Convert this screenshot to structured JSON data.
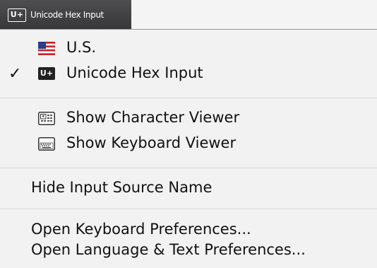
{
  "menubar": {
    "badge": "U+",
    "title": "Unicode Hex Input"
  },
  "menu": {
    "items": [
      {
        "label": "U.S.",
        "icon": "us-flag-icon",
        "checked": false
      },
      {
        "label": "Unicode Hex Input",
        "icon": "unicode-hex-icon",
        "checked": true,
        "badge": "U+",
        "check_mark": "✓"
      },
      {
        "label": "Show Character Viewer",
        "icon": "character-viewer-icon"
      },
      {
        "label": "Show Keyboard Viewer",
        "icon": "keyboard-viewer-icon"
      },
      {
        "label": "Hide Input Source Name"
      },
      {
        "label": "Open Keyboard Preferences..."
      },
      {
        "label": "Open Language & Text Preferences..."
      }
    ]
  }
}
